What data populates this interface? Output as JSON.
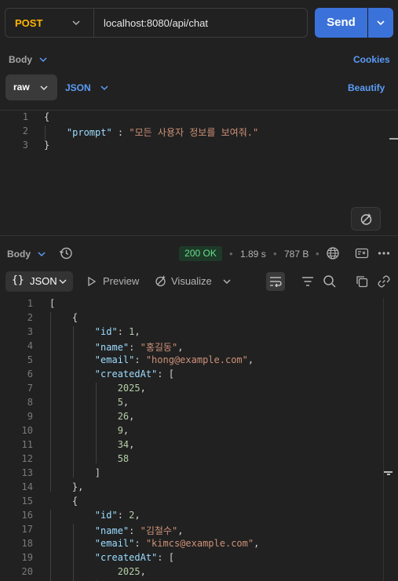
{
  "request": {
    "method": "POST",
    "url": "localhost:8080/api/chat",
    "send_label": "Send",
    "body_tab": "Body",
    "cookies_label": "Cookies",
    "body_mode": "raw",
    "body_format": "JSON",
    "beautify_label": "Beautify",
    "body_lines": [
      {
        "n": "1",
        "tokens": [
          {
            "t": "{",
            "c": "pun"
          }
        ]
      },
      {
        "n": "2",
        "tokens": [
          {
            "t": "    \"prompt\"",
            "c": "key"
          },
          {
            "t": " : ",
            "c": "pun"
          },
          {
            "t": "\"모든 사용자 정보를 보여줘.\"",
            "c": "str"
          }
        ]
      },
      {
        "n": "3",
        "tokens": [
          {
            "t": "}",
            "c": "pun"
          }
        ]
      }
    ]
  },
  "response": {
    "body_tab": "Body",
    "status": "200 OK",
    "time": "1.89 s",
    "size": "787 B",
    "format": "JSON",
    "preview_label": "Preview",
    "visualize_label": "Visualize",
    "lines": [
      {
        "n": "1",
        "tokens": [
          {
            "t": "[",
            "c": "pun"
          }
        ]
      },
      {
        "n": "2",
        "tokens": [
          {
            "t": "    {",
            "c": "pun"
          }
        ]
      },
      {
        "n": "3",
        "tokens": [
          {
            "t": "        \"id\"",
            "c": "key"
          },
          {
            "t": ": ",
            "c": "pun"
          },
          {
            "t": "1",
            "c": "num"
          },
          {
            "t": ",",
            "c": "pun"
          }
        ]
      },
      {
        "n": "4",
        "tokens": [
          {
            "t": "        \"name\"",
            "c": "key"
          },
          {
            "t": ": ",
            "c": "pun"
          },
          {
            "t": "\"홍길동\"",
            "c": "str"
          },
          {
            "t": ",",
            "c": "pun"
          }
        ]
      },
      {
        "n": "5",
        "tokens": [
          {
            "t": "        \"email\"",
            "c": "key"
          },
          {
            "t": ": ",
            "c": "pun"
          },
          {
            "t": "\"hong@example.com\"",
            "c": "str"
          },
          {
            "t": ",",
            "c": "pun"
          }
        ]
      },
      {
        "n": "6",
        "tokens": [
          {
            "t": "        \"createdAt\"",
            "c": "key"
          },
          {
            "t": ": [",
            "c": "pun"
          }
        ]
      },
      {
        "n": "7",
        "tokens": [
          {
            "t": "            2025",
            "c": "num"
          },
          {
            "t": ",",
            "c": "pun"
          }
        ]
      },
      {
        "n": "8",
        "tokens": [
          {
            "t": "            5",
            "c": "num"
          },
          {
            "t": ",",
            "c": "pun"
          }
        ]
      },
      {
        "n": "9",
        "tokens": [
          {
            "t": "            26",
            "c": "num"
          },
          {
            "t": ",",
            "c": "pun"
          }
        ]
      },
      {
        "n": "10",
        "tokens": [
          {
            "t": "            9",
            "c": "num"
          },
          {
            "t": ",",
            "c": "pun"
          }
        ]
      },
      {
        "n": "11",
        "tokens": [
          {
            "t": "            34",
            "c": "num"
          },
          {
            "t": ",",
            "c": "pun"
          }
        ]
      },
      {
        "n": "12",
        "tokens": [
          {
            "t": "            58",
            "c": "num"
          }
        ]
      },
      {
        "n": "13",
        "tokens": [
          {
            "t": "        ]",
            "c": "pun"
          }
        ]
      },
      {
        "n": "14",
        "tokens": [
          {
            "t": "    },",
            "c": "pun"
          }
        ]
      },
      {
        "n": "15",
        "tokens": [
          {
            "t": "    {",
            "c": "pun"
          }
        ]
      },
      {
        "n": "16",
        "tokens": [
          {
            "t": "        \"id\"",
            "c": "key"
          },
          {
            "t": ": ",
            "c": "pun"
          },
          {
            "t": "2",
            "c": "num"
          },
          {
            "t": ",",
            "c": "pun"
          }
        ]
      },
      {
        "n": "17",
        "tokens": [
          {
            "t": "        \"name\"",
            "c": "key"
          },
          {
            "t": ": ",
            "c": "pun"
          },
          {
            "t": "\"김철수\"",
            "c": "str"
          },
          {
            "t": ",",
            "c": "pun"
          }
        ]
      },
      {
        "n": "18",
        "tokens": [
          {
            "t": "        \"email\"",
            "c": "key"
          },
          {
            "t": ": ",
            "c": "pun"
          },
          {
            "t": "\"kimcs@example.com\"",
            "c": "str"
          },
          {
            "t": ",",
            "c": "pun"
          }
        ]
      },
      {
        "n": "19",
        "tokens": [
          {
            "t": "        \"createdAt\"",
            "c": "key"
          },
          {
            "t": ": [",
            "c": "pun"
          }
        ]
      },
      {
        "n": "20",
        "tokens": [
          {
            "t": "            2025",
            "c": "num"
          },
          {
            "t": ",",
            "c": "pun"
          }
        ]
      }
    ]
  },
  "colors": {
    "accent": "#3b72d9",
    "method": "#ffb400",
    "status_ok": "#6bdc8f",
    "key": "#9cdcfe",
    "string": "#ce9178",
    "number": "#b5cea8"
  }
}
